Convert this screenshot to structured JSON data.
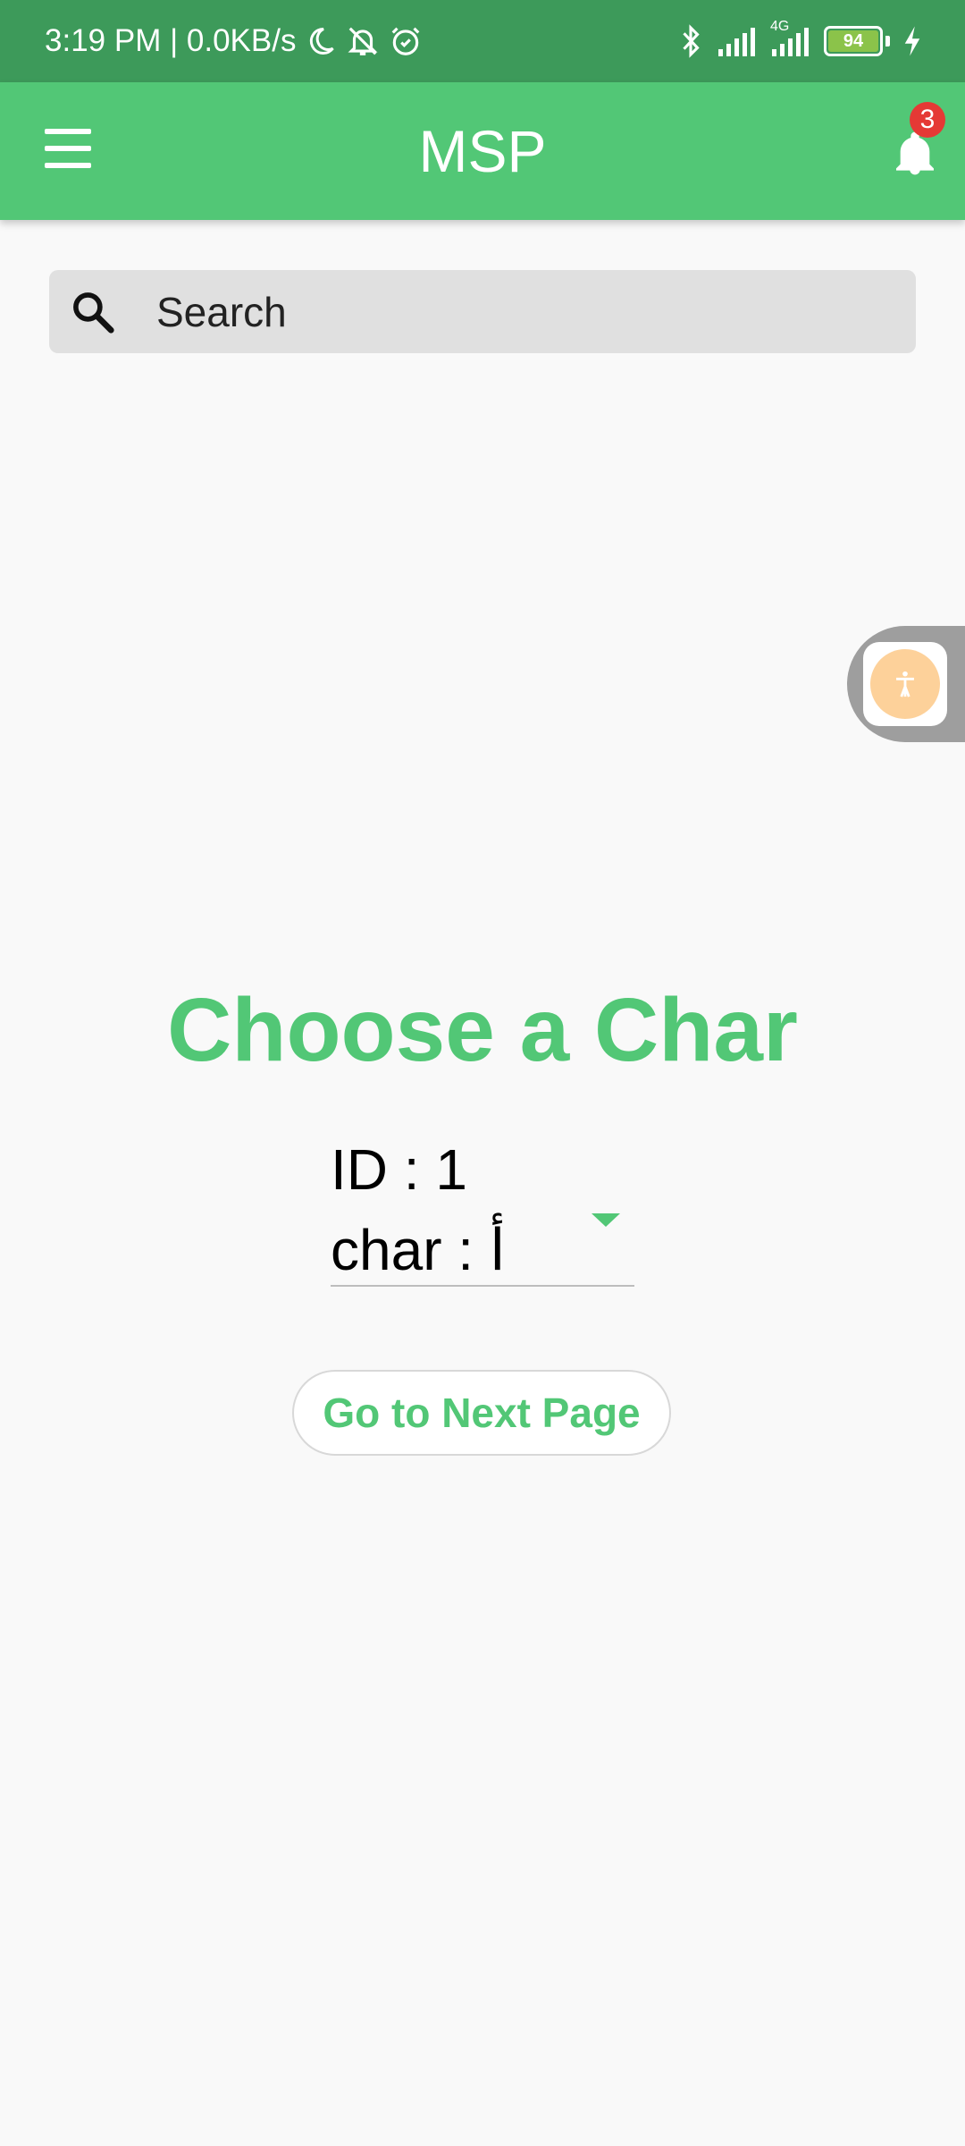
{
  "status_bar": {
    "time_speed": "3:19 PM | 0.0KB/s",
    "network_label": "4G",
    "battery": "94",
    "icons": [
      "moon-icon",
      "bell-off-icon",
      "alarm-icon",
      "bluetooth-icon",
      "signal-icon",
      "signal-icon",
      "battery-icon",
      "charging-icon"
    ]
  },
  "app_bar": {
    "title": "MSP",
    "menu_icon": "hamburger-menu-icon",
    "notification_icon": "bell-icon",
    "notification_count": "3"
  },
  "search": {
    "placeholder": "Search",
    "icon": "search-icon"
  },
  "accessibility_button": {
    "icon": "accessibility-icon"
  },
  "main": {
    "heading": "Choose a Char",
    "dropdown": {
      "id_text": "ID : 1",
      "char_text": "char : أ",
      "icon": "dropdown-arrow-icon"
    },
    "next_button": "Go to Next Page"
  },
  "colors": {
    "status_bar": "#3d9a5a",
    "app_bar": "#52c776",
    "accent": "#52c776",
    "badge": "#e53935",
    "background": "#f9f9f9"
  }
}
